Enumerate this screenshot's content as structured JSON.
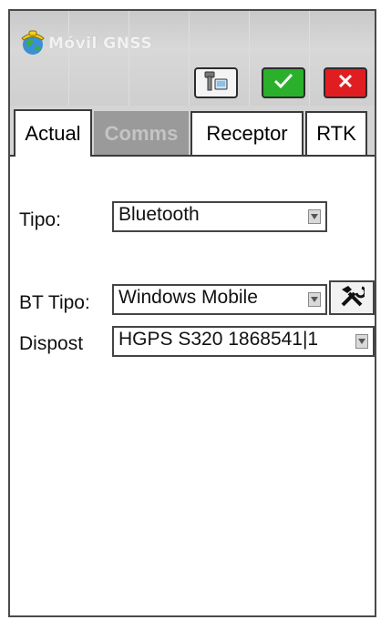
{
  "window": {
    "title": "Móvil GNSS"
  },
  "toolbar": {
    "device_icon": "gps-receiver-icon",
    "ok_icon": "check-icon",
    "cancel_icon": "close-icon"
  },
  "tabs": [
    {
      "label": "Actual",
      "active": true,
      "enabled": true
    },
    {
      "label": "Comms",
      "active": false,
      "enabled": false
    },
    {
      "label": "Receptor",
      "active": false,
      "enabled": true
    },
    {
      "label": "RTK",
      "active": false,
      "enabled": true
    }
  ],
  "form": {
    "tipo": {
      "label": "Tipo:",
      "value": "Bluetooth"
    },
    "bt_tipo": {
      "label": "BT Tipo:",
      "value": "Windows Mobile"
    },
    "dispost": {
      "label": "Dispost",
      "value": "HGPS S320 1868541|1"
    }
  },
  "colors": {
    "ok": "#2bb02b",
    "cancel": "#e01e22",
    "disabled_tab": "#9a9a9a"
  }
}
